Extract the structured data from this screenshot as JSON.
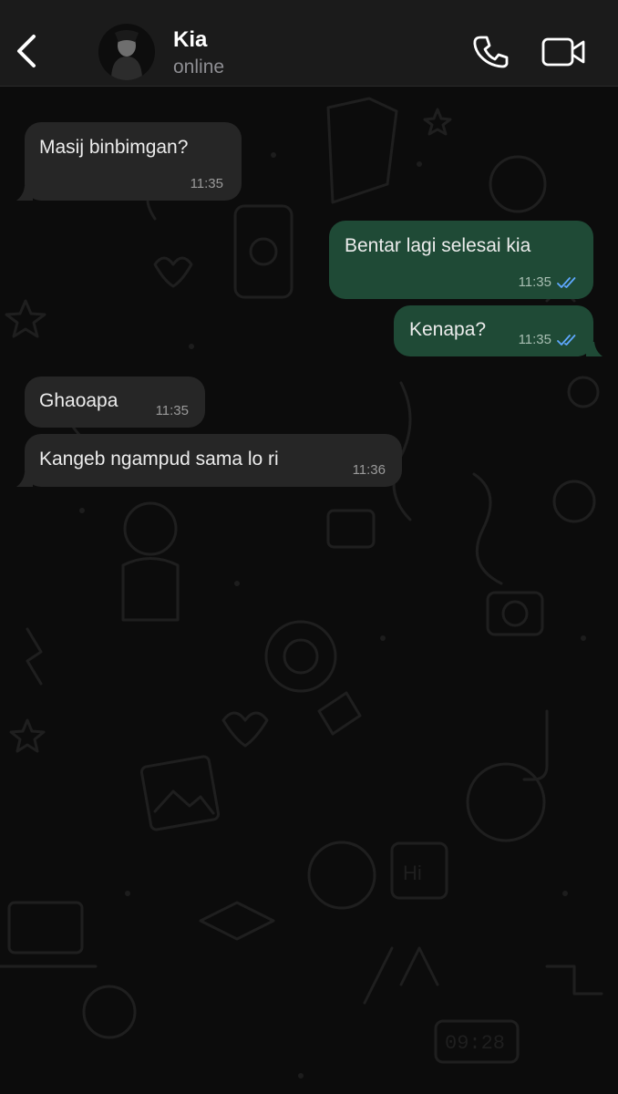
{
  "header": {
    "back_icon": "chevron-left-icon",
    "contact_name": "Kia",
    "status": "online",
    "call_icon": "phone-icon",
    "video_icon": "video-camera-icon"
  },
  "messages": [
    {
      "direction": "incoming",
      "text": "Masij binbimgan?",
      "time": "11:35"
    },
    {
      "direction": "outgoing",
      "text": "Bentar lagi selesai kia",
      "time": "11:35",
      "read": true
    },
    {
      "direction": "outgoing",
      "text": "Kenapa?",
      "time": "11:35",
      "read": true
    },
    {
      "direction": "incoming",
      "text": "Ghaoapa",
      "time": "11:35"
    },
    {
      "direction": "incoming",
      "text": "Kangeb ngampud sama lo ri",
      "time": "11:36"
    }
  ],
  "colors": {
    "incoming_bubble": "#262626",
    "outgoing_bubble": "#1f4a36",
    "read_ticks": "#5fa8ff",
    "header_bg": "#1b1b1b"
  },
  "wallpaper_clock": "09:28",
  "wallpaper_sticker": "Hi"
}
